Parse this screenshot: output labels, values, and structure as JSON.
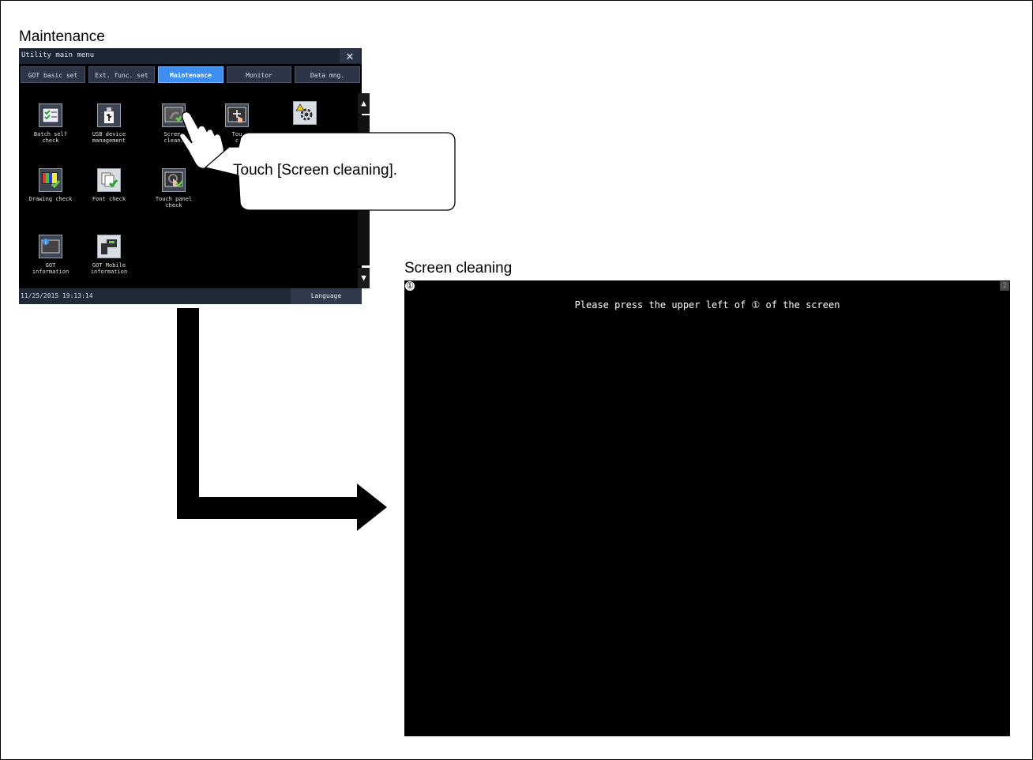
{
  "captions": {
    "maintenance": "Maintenance",
    "screen_cleaning": "Screen cleaning"
  },
  "got": {
    "title": "Utility main menu",
    "close_glyph": "✕",
    "tabs": [
      "GOT basic set",
      "Ext. func. set",
      "Maintenance",
      "Monitor",
      "Data mng."
    ],
    "active_tab": "Maintenance",
    "tiles": [
      {
        "label": "Batch self\ncheck",
        "icon": "checklist-icon"
      },
      {
        "label": "USB device\nmanagement",
        "icon": "usb-icon"
      },
      {
        "label": "Screen\ncleani",
        "icon": "screen-cleaning-icon"
      },
      {
        "label": "Tou\nc",
        "icon": "touch-panel-calibration-icon"
      },
      {
        "label": "",
        "icon": "gear-warning-icon"
      },
      {
        "label": "Drawing check",
        "icon": "drawing-check-icon"
      },
      {
        "label": "Font check",
        "icon": "font-check-icon"
      },
      {
        "label": "Touch panel\ncheck",
        "icon": "touch-panel-check-icon"
      },
      {
        "label": "GOT\ninformation",
        "icon": "info-icon"
      },
      {
        "label": "GOT Mobile\ninformation",
        "icon": "mobile-icon"
      }
    ],
    "datetime": "11/25/2015 19:13:14",
    "language_label": "Language"
  },
  "callout": {
    "text": "Touch [Screen cleaning]."
  },
  "cleaning": {
    "marker1": "①",
    "marker2": "②",
    "message": "Please press the upper left of ① of the screen"
  },
  "colors": {
    "active_tab": "#3c8ff0",
    "titlebar": "#1c2533",
    "check_green": "#5fd14a"
  }
}
